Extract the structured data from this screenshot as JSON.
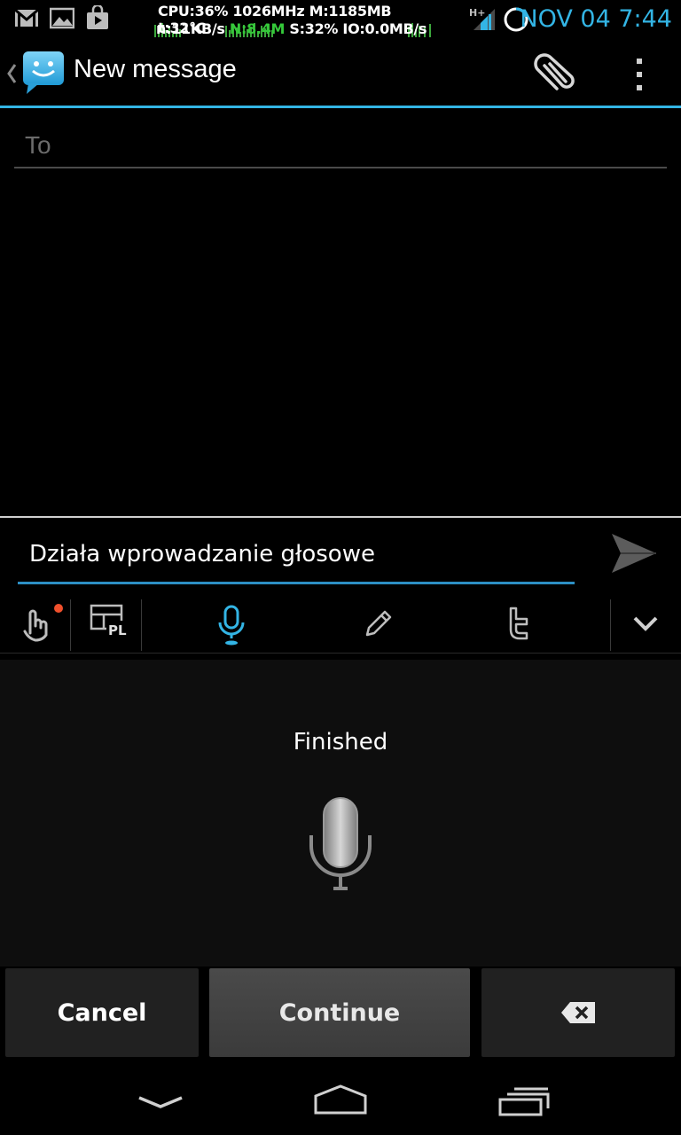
{
  "status_bar": {
    "notification_icons": [
      "gmail-icon",
      "gallery-icon",
      "play-store-icon"
    ],
    "sysinfo_line1": "CPU:36% 1026MHz M:1185MB t:32°C",
    "sysinfo_line2_a": "n:11KB/s ",
    "sysinfo_line2_b": "N:8.4M",
    "sysinfo_line2_c": " S:32% IO:0.0MB/s",
    "network_label": "H+",
    "clock": "NOV 04 7:44"
  },
  "action_bar": {
    "title": "New message",
    "accent_color": "#33b5e5"
  },
  "recipient": {
    "placeholder": "To"
  },
  "compose": {
    "text": "Działa wprowadzanie głosowe"
  },
  "keyboard_toolbar": {
    "layout_badge": "PL",
    "items": [
      "gesture-icon",
      "layout-pl-icon",
      "microphone-icon",
      "pencil-icon",
      "twitter-icon",
      "chevron-down-icon"
    ]
  },
  "voice": {
    "status": "Finished"
  },
  "buttons": {
    "cancel": "Cancel",
    "continue": "Continue"
  }
}
